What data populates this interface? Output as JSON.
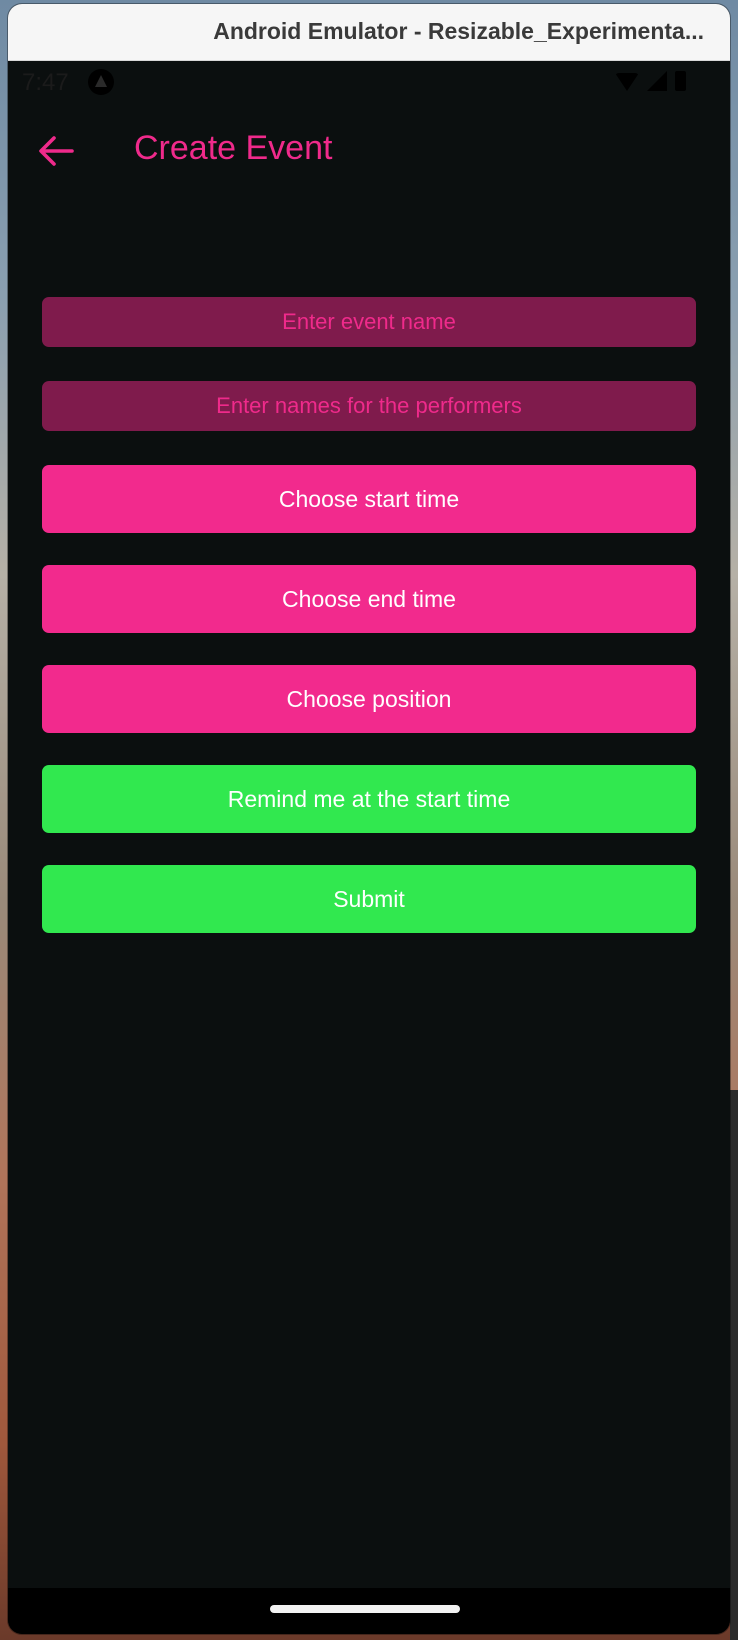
{
  "window": {
    "title": "Android Emulator - Resizable_Experimenta..."
  },
  "statusbar": {
    "time": "7:47",
    "icons": [
      "notification-icon",
      "wifi-icon",
      "signal-icon",
      "battery-icon"
    ]
  },
  "appbar": {
    "title": "Create Event",
    "back_icon": "arrow-back-icon"
  },
  "form": {
    "event_name_placeholder": "Enter event name",
    "event_name_value": "",
    "performers_placeholder": "Enter names for the performers",
    "performers_value": "",
    "start_time_label": "Choose start time",
    "end_time_label": "Choose end time",
    "position_label": "Choose position",
    "remind_label": "Remind me at the start time",
    "submit_label": "Submit"
  },
  "colors": {
    "accent_pink": "#f22a8d",
    "field_bg": "#7f1b4c",
    "accent_green": "#31e84f",
    "screen_bg": "#0b0f0f"
  }
}
